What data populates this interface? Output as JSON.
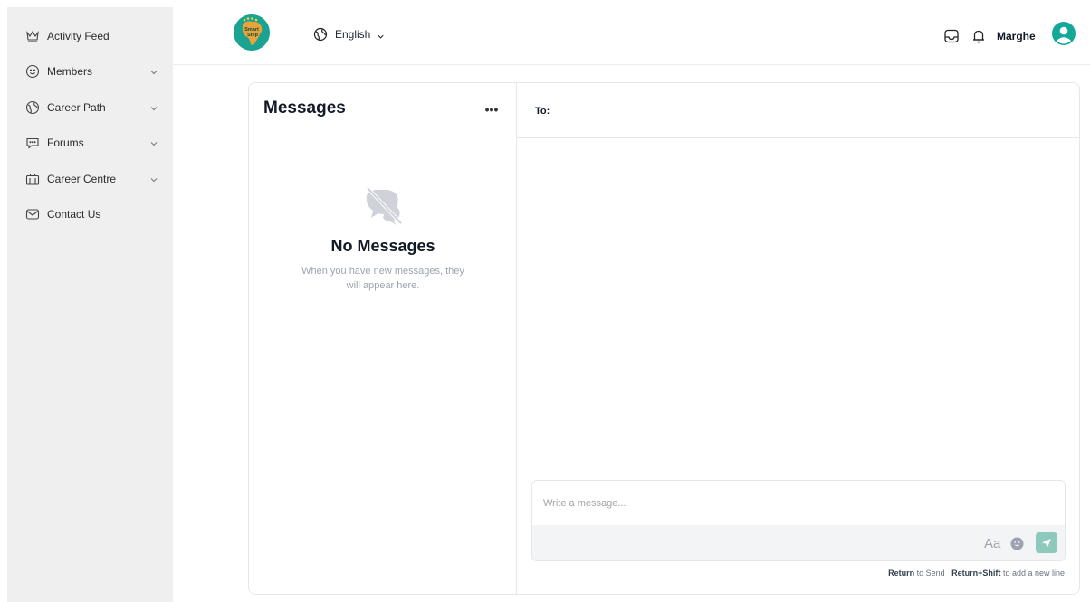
{
  "sidebar": {
    "items": [
      {
        "label": "Activity Feed",
        "icon": "crown-icon",
        "has_chevron": false
      },
      {
        "label": "Members",
        "icon": "smiley-icon",
        "has_chevron": true
      },
      {
        "label": "Career Path",
        "icon": "globe-icon",
        "has_chevron": true
      },
      {
        "label": "Forums",
        "icon": "chat-bubble-icon",
        "has_chevron": true
      },
      {
        "label": "Career Centre",
        "icon": "briefcase-icon",
        "has_chevron": true
      },
      {
        "label": "Contact Us",
        "icon": "envelope-icon",
        "has_chevron": false
      }
    ]
  },
  "header": {
    "logo_text_line1": "Smart",
    "logo_text_line2": "Step",
    "language": "English",
    "username": "Marghe"
  },
  "messages": {
    "title": "Messages",
    "more_label": "•••",
    "empty_title": "No Messages",
    "empty_description": "When you have new messages, they will appear here."
  },
  "compose": {
    "to_label": "To:",
    "message_placeholder": "Write a message...",
    "format_label": "Aa",
    "hint_send_key": "Return",
    "hint_send_text": " to Send",
    "hint_newline_key": "Return+Shift",
    "hint_newline_text": " to add a new line"
  },
  "colors": {
    "sidebar_bg": "#efefef",
    "brand_teal": "#1aa391",
    "send_button": "#8dc9bd",
    "avatar": "#15a898"
  }
}
